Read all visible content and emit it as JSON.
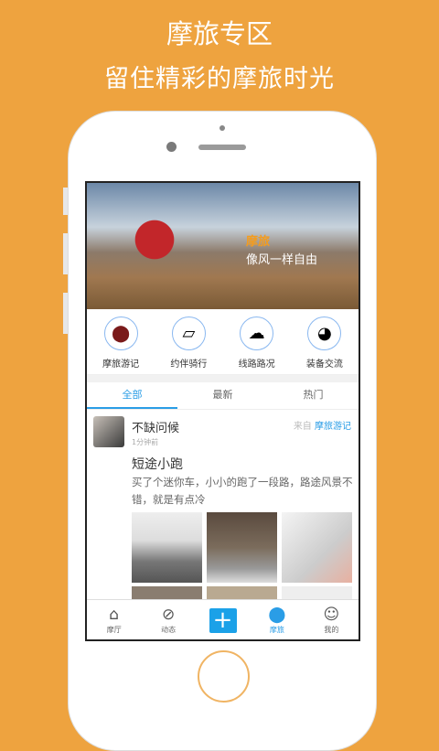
{
  "promo": {
    "title": "摩旅专区",
    "subtitle": "留住精彩的摩旅时光"
  },
  "banner": {
    "brand": "摩旅",
    "slogan": "像风一样自由"
  },
  "categories": [
    {
      "label": "摩旅游记",
      "icon": "map-pin-wheel-icon"
    },
    {
      "label": "约伴骑行",
      "icon": "phone-bike-icon"
    },
    {
      "label": "线路路况",
      "icon": "route-icon"
    },
    {
      "label": "装备交流",
      "icon": "helmet-icon"
    }
  ],
  "tabs": [
    "全部",
    "最新",
    "热门"
  ],
  "post": {
    "user": "不缺问候",
    "time": "1分钟前",
    "from_label": "来自",
    "from_source": "摩旅游记",
    "title": "短途小跑",
    "body": "买了个迷你车，小小的跑了一段路，路途风景不错，就是有点冷"
  },
  "nav": [
    {
      "label": "摩厅",
      "icon": "home-icon"
    },
    {
      "label": "动态",
      "icon": "compass-icon"
    },
    {
      "label": "",
      "icon": "plus-icon"
    },
    {
      "label": "摩旅",
      "icon": "location-icon"
    },
    {
      "label": "我的",
      "icon": "user-icon"
    }
  ]
}
